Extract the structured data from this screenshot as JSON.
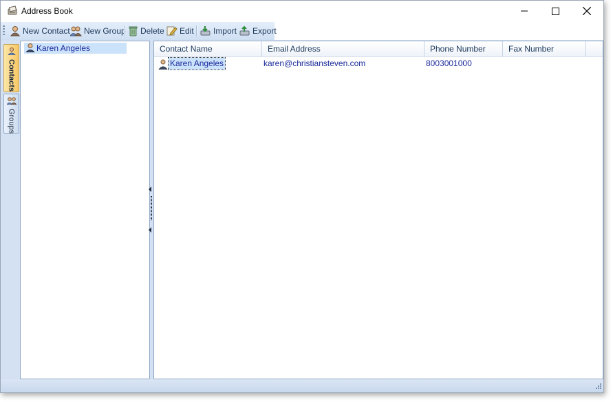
{
  "window": {
    "title": "Address Book",
    "icon": "address-book-icon"
  },
  "window_controls": {
    "minimize": "minimize-icon",
    "maximize": "maximize-icon",
    "close": "close-icon"
  },
  "toolbar": {
    "items": [
      {
        "label": "New Contact",
        "icon": "contact-icon"
      },
      {
        "label": "New Group",
        "icon": "group-icon"
      },
      {
        "label": "Delete",
        "icon": "trash-icon"
      },
      {
        "label": "Edit",
        "icon": "pencil-icon"
      },
      {
        "label": "Import",
        "icon": "import-icon"
      },
      {
        "label": "Export",
        "icon": "export-icon"
      }
    ]
  },
  "side_tabs": [
    {
      "label": "Contacts",
      "icon": "contacts-icon",
      "active": true
    },
    {
      "label": "Groups",
      "icon": "groups-icon",
      "active": false
    }
  ],
  "tree": {
    "items": [
      {
        "label": "Karen Angeles",
        "icon": "contact-icon"
      }
    ]
  },
  "grid": {
    "columns": [
      "Contact Name",
      "Email Address",
      "Phone Number",
      "Fax Number"
    ],
    "rows": [
      {
        "name": "Karen Angeles",
        "email": "karen@christiansteven.com",
        "phone": "8003001000",
        "fax": ""
      }
    ]
  },
  "colors": {
    "accent": "#cbe2fb",
    "active_tab": "#f7c765",
    "panel_bg": "#d4e1f2",
    "text_link": "#1b2b9b"
  }
}
